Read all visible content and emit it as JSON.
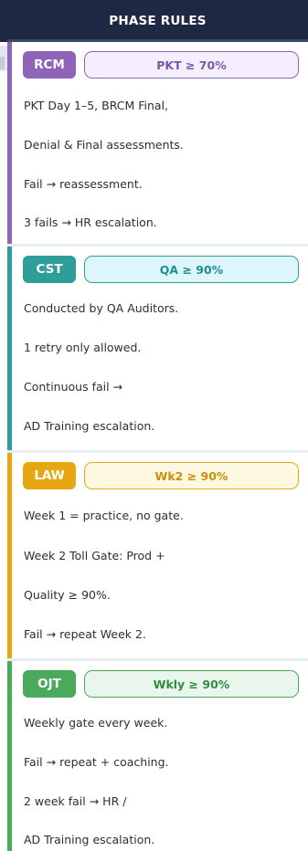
{
  "panel": {
    "title": "PHASE RULES"
  },
  "sections": [
    {
      "code": "RCM",
      "rule": "PKT ≥ 70%",
      "accent": "#8e63b8",
      "pill_bg": "#f4efff",
      "pill_text": "#7b56ab",
      "lines": [
        "PKT Day 1–5, BRCM Final,",
        "Denial & Final assessments.",
        "Fail → reassessment.",
        "3 fails → HR escalation."
      ]
    },
    {
      "code": "CST",
      "rule": "QA ≥ 90%",
      "accent": "#2e9e9a",
      "pill_bg": "#ddf6fa",
      "pill_text": "#1f8d97",
      "lines": [
        "Conducted by QA Auditors.",
        "1 retry only allowed.",
        "Continuous fail →",
        "AD Training escalation."
      ]
    },
    {
      "code": "LAW",
      "rule": "Wk2 ≥ 90%",
      "accent": "#e8a712",
      "pill_bg": "#fff8e1",
      "pill_text": "#c98e0a",
      "lines": [
        "Week 1 = practice, no gate.",
        "Week 2 Toll Gate: Prod +",
        "Quality ≥ 90%.",
        "Fail → repeat Week 2."
      ]
    },
    {
      "code": "OJT",
      "rule": "Wkly ≥ 90%",
      "accent": "#4aaa5c",
      "pill_bg": "#eaf6ec",
      "pill_text": "#2f8c43",
      "lines": [
        "Weekly gate every week.",
        "Fail → repeat + coaching.",
        "2 week fail → HR /",
        "AD Training escalation."
      ]
    }
  ]
}
